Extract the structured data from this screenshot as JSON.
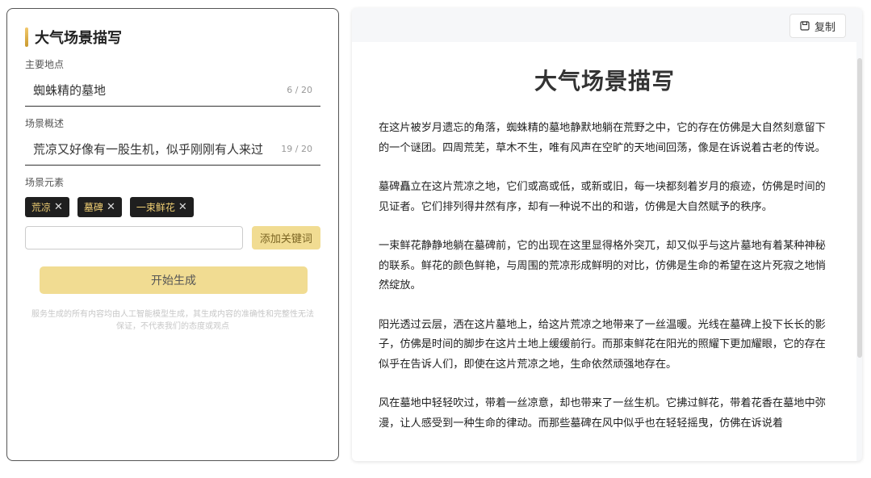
{
  "left": {
    "title": "大气场景描写",
    "location": {
      "label": "主要地点",
      "value": "蜘蛛精的墓地",
      "counter": "6 / 20"
    },
    "summary": {
      "label": "场景概述",
      "value": "荒凉又好像有一股生机，似乎刚刚有人来过",
      "counter": "19 / 20"
    },
    "elements": {
      "label": "场景元素",
      "tags": [
        "荒凉",
        "墓碑",
        "一束鲜花"
      ]
    },
    "keyword": {
      "value": "",
      "button": "添加关键词"
    },
    "generate_button": "开始生成",
    "disclaimer": "服务生成的所有内容均由人工智能模型生成，其生成内容的准确性和完整性无法保证，不代表我们的态度或观点"
  },
  "right": {
    "copy_button": "复制",
    "doc_title": "大气场景描写",
    "paragraphs": [
      "在这片被岁月遗忘的角落，蜘蛛精的墓地静默地躺在荒野之中，它的存在仿佛是大自然刻意留下的一个谜团。四周荒芜，草木不生，唯有风声在空旷的天地间回荡，像是在诉说着古老的传说。",
      "墓碑矗立在这片荒凉之地，它们或高或低，或新或旧，每一块都刻着岁月的痕迹，仿佛是时间的见证者。它们排列得井然有序，却有一种说不出的和谐，仿佛是大自然赋予的秩序。",
      "一束鲜花静静地躺在墓碑前，它的出现在这里显得格外突兀，却又似乎与这片墓地有着某种神秘的联系。鲜花的颜色鲜艳，与周围的荒凉形成鲜明的对比，仿佛是生命的希望在这片死寂之地悄然绽放。",
      "阳光透过云层，洒在这片墓地上，给这片荒凉之地带来了一丝温暖。光线在墓碑上投下长长的影子，仿佛是时间的脚步在这片土地上缓缓前行。而那束鲜花在阳光的照耀下更加耀眼，它的存在似乎在告诉人们，即使在这片荒凉之地，生命依然顽强地存在。",
      "风在墓地中轻轻吹过，带着一丝凉意，却也带来了一丝生机。它拂过鲜花，带着花香在墓地中弥漫，让人感受到一种生命的律动。而那些墓碑在风中似乎也在轻轻摇曳，仿佛在诉说着"
    ]
  }
}
